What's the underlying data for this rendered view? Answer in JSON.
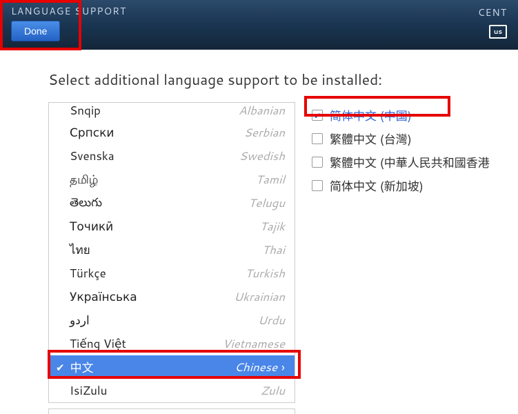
{
  "header": {
    "title": "LANGUAGE SUPPORT",
    "done_label": "Done",
    "right_label": "CENT",
    "kbd_label": "us"
  },
  "instruction": "Select additional language support to be installed:",
  "languages": [
    {
      "native": "Snqip",
      "english": "Albanian",
      "selected": false
    },
    {
      "native": "Српски",
      "english": "Serbian",
      "selected": false
    },
    {
      "native": "Svenska",
      "english": "Swedish",
      "selected": false
    },
    {
      "native": "தமிழ்",
      "english": "Tamil",
      "selected": false
    },
    {
      "native": "తెలుగు",
      "english": "Telugu",
      "selected": false
    },
    {
      "native": "Точикӣ",
      "english": "Tajik",
      "selected": false
    },
    {
      "native": "ไทย",
      "english": "Thai",
      "selected": false
    },
    {
      "native": "Türkçe",
      "english": "Turkish",
      "selected": false
    },
    {
      "native": "Українська",
      "english": "Ukrainian",
      "selected": false
    },
    {
      "native": "اردو",
      "english": "Urdu",
      "selected": false
    },
    {
      "native": "Tiếng Việt",
      "english": "Vietnamese",
      "selected": false
    },
    {
      "native": "中文",
      "english": "Chinese",
      "selected": true
    },
    {
      "native": "IsiZulu",
      "english": "Zulu",
      "selected": false
    }
  ],
  "variants": [
    {
      "label": "简体中文 (中国)",
      "checked": true
    },
    {
      "label": "繁體中文 (台灣)",
      "checked": false
    },
    {
      "label": "繁體中文 (中華人民共和國香港",
      "checked": false
    },
    {
      "label": "简体中文 (新加坡)",
      "checked": false
    }
  ]
}
